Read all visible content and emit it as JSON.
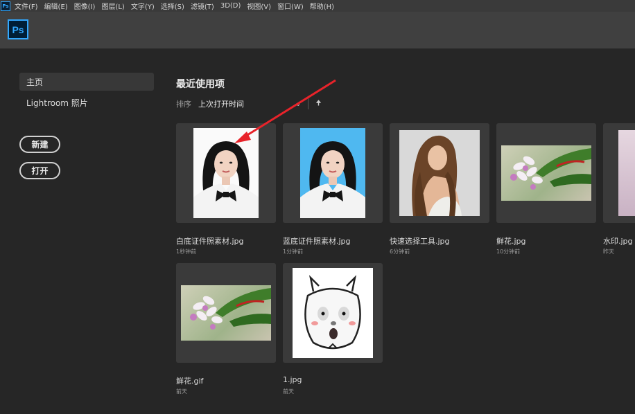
{
  "menubar": {
    "app_icon": "Ps",
    "items": [
      "文件(F)",
      "编辑(E)",
      "图像(I)",
      "图层(L)",
      "文字(Y)",
      "选择(S)",
      "滤镜(T)",
      "3D(D)",
      "视图(V)",
      "窗口(W)",
      "帮助(H)"
    ]
  },
  "header": {
    "logo": "Ps"
  },
  "sidebar": {
    "items": [
      {
        "label": "主页"
      },
      {
        "label": "Lightroom 照片"
      }
    ],
    "new_button": "新建",
    "open_button": "打开"
  },
  "main": {
    "title": "最近使用项",
    "sort_label": "排序",
    "sort_value": "上次打开时间",
    "files": [
      {
        "name": "白底证件照素材.jpg",
        "time": "1秒钟前"
      },
      {
        "name": "蓝底证件照素材.jpg",
        "time": "1分钟前"
      },
      {
        "name": "快速选择工具.jpg",
        "time": "6分钟前"
      },
      {
        "name": "鲜花.jpg",
        "time": "10分钟前"
      },
      {
        "name": "水印.jpg",
        "time": "昨天"
      },
      {
        "name": "鲜花.gif",
        "time": "前天"
      },
      {
        "name": "1.jpg",
        "time": "前天"
      }
    ]
  },
  "colors": {
    "accent": "#31a8ff",
    "annotation_arrow": "#e8232a"
  }
}
